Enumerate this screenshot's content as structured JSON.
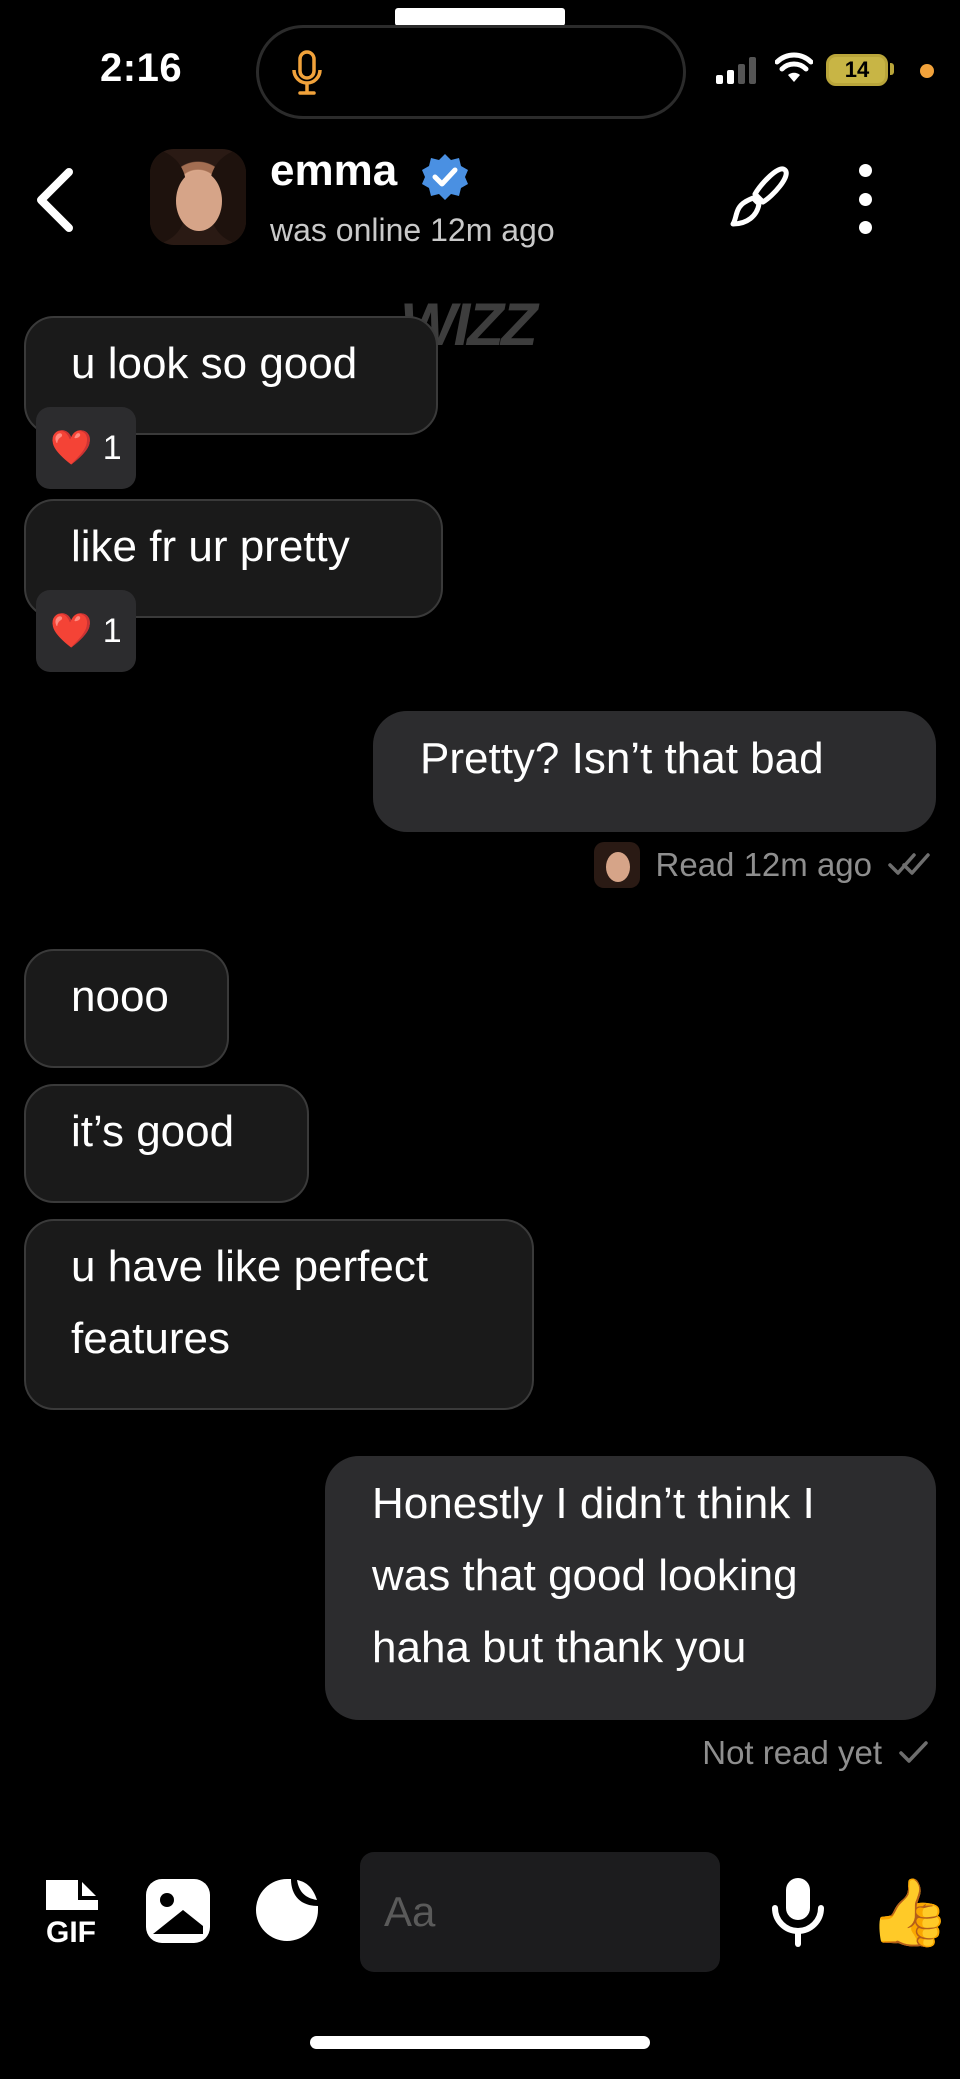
{
  "status_bar": {
    "time": "2:16",
    "battery": "14"
  },
  "header": {
    "name": "emma",
    "status": "was online 12m ago"
  },
  "watermark": "WIZZ",
  "messages": [
    {
      "direction": "in",
      "text": "u look so good",
      "reaction": {
        "emoji": "❤️",
        "count": "1"
      }
    },
    {
      "direction": "in",
      "text": "like fr ur pretty",
      "reaction": {
        "emoji": "❤️",
        "count": "1"
      }
    },
    {
      "direction": "out",
      "text": "Pretty? Isn’t that bad",
      "receipt": "Read 12m ago"
    },
    {
      "direction": "in",
      "text": "nooo"
    },
    {
      "direction": "in",
      "text": "it’s good"
    },
    {
      "direction": "in",
      "text": "u have like perfect features"
    },
    {
      "direction": "out",
      "text": "Honestly I didn’t think I was that good looking haha but thank you",
      "receipt": "Not read yet"
    }
  ],
  "composer": {
    "gif_label": "GIF",
    "placeholder": "Aa",
    "like_emoji": "👍"
  },
  "colors": {
    "background": "#000000",
    "incoming_bubble": "#1a1a1a",
    "outgoing_bubble": "#2c2c2e",
    "verified": "#4a90e2",
    "battery": "#c8b545"
  }
}
